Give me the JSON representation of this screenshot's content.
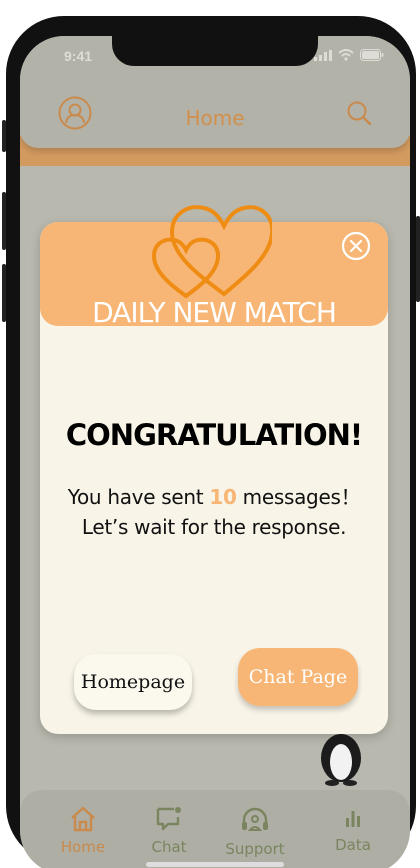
{
  "status_bar": {
    "time": "9:41"
  },
  "header": {
    "title": "Home"
  },
  "modal": {
    "banner_title": "DAILY NEW MATCH",
    "heading": "CONGRATULATION!",
    "message_prefix": "You have sent",
    "message_count": "10",
    "message_suffix": "messages！",
    "message_line2": "Let’s wait for the response.",
    "homepage_button": "Homepage",
    "chat_page_button": "Chat Page"
  },
  "tabbar": {
    "tabs": [
      {
        "label": "Home",
        "icon": "home-icon",
        "active": true
      },
      {
        "label": "Chat",
        "icon": "chat-icon",
        "active": false
      },
      {
        "label": "Support",
        "icon": "support-icon",
        "active": false
      },
      {
        "label": "Data",
        "icon": "data-icon",
        "active": false
      }
    ]
  },
  "colors": {
    "accent": "#f7b676",
    "accent_dark": "#ef8c14",
    "header_text": "#d28f4b",
    "tab_inactive": "#7a8560",
    "background": "#b8b8ae",
    "modal_bg": "#f8f4e8"
  }
}
